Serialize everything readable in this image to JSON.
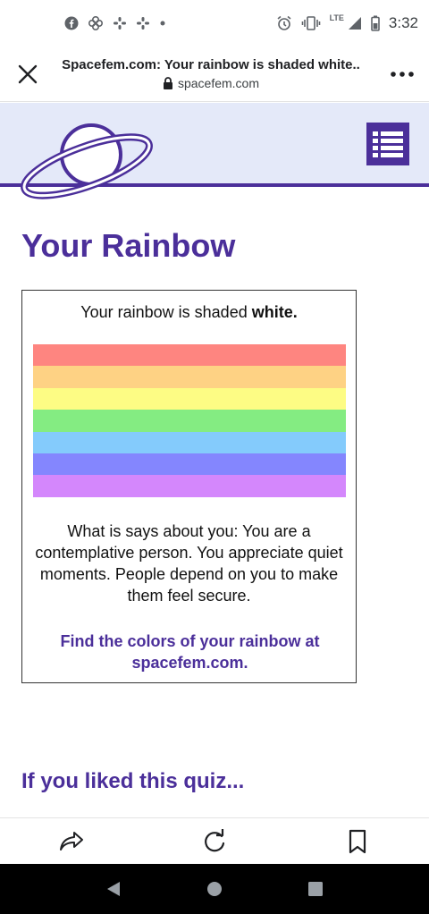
{
  "status_bar": {
    "time": "3:32",
    "network": "LTE",
    "icons_left": [
      "facebook-icon",
      "pinwheel-icon",
      "slack-icon",
      "slack-icon",
      "dot-icon"
    ],
    "icons_right": [
      "alarm-icon",
      "vibrate-icon",
      "signal-icon",
      "battery-icon"
    ]
  },
  "toolbar": {
    "title": "Spacefem.com: Your rainbow is shaded white..",
    "url": "spacefem.com",
    "close_icon": "close-icon",
    "more_icon": "more-icon",
    "lock_icon": "lock-icon"
  },
  "header": {
    "logo_icon": "planet-logo-icon",
    "menu_icon": "menu-icon",
    "accent_color": "#4b2f9a",
    "background_color": "#e4e9f9"
  },
  "main": {
    "heading": "Your Rainbow",
    "result_prefix": "Your rainbow is shaded ",
    "result_color": "white.",
    "rainbow_stripes": [
      "#fe8580",
      "#fed284",
      "#fdfc84",
      "#84ec82",
      "#84cbfc",
      "#8486fe",
      "#d487fc"
    ],
    "description": "What is says about you: You are a contemplative person. You appreciate quiet moments. People depend on you to make them feel secure.",
    "link_text": "Find the colors of your rainbow at spacefem.com.",
    "subheading": "If you liked this quiz..."
  },
  "bottom_bar": {
    "share_icon": "share-icon",
    "refresh_icon": "refresh-icon",
    "bookmark_icon": "bookmark-icon"
  },
  "nav_bar": {
    "back_icon": "back-triangle-icon",
    "home_icon": "home-circle-icon",
    "recents_icon": "recents-square-icon"
  }
}
